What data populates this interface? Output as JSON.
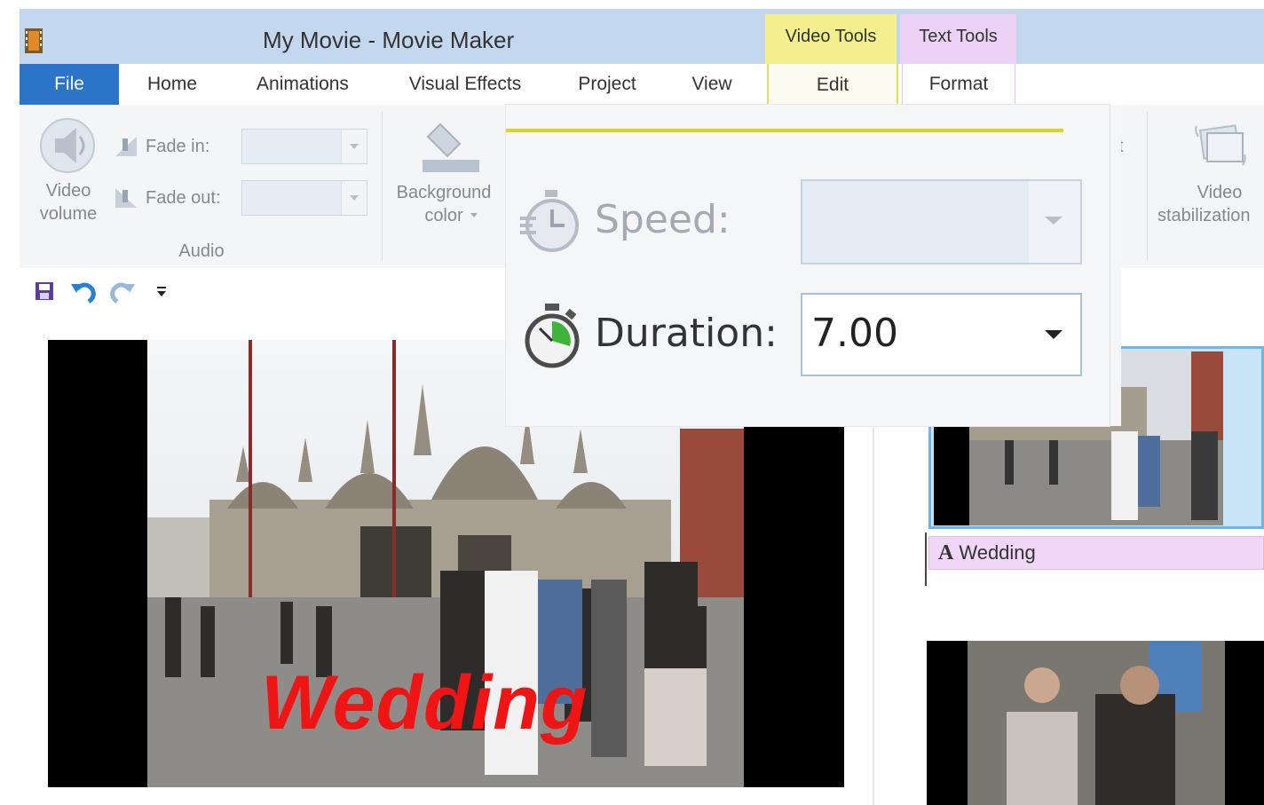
{
  "window": {
    "title": "My Movie - Movie Maker"
  },
  "context_tabs": {
    "video_tools": "Video Tools",
    "text_tools": "Text Tools"
  },
  "tabs": [
    "File",
    "Home",
    "Animations",
    "Visual Effects",
    "Project",
    "View",
    "Edit",
    "Format"
  ],
  "ribbon": {
    "video_volume": [
      "Video",
      "volume"
    ],
    "fade_in": "Fade in:",
    "fade_out": "Fade out:",
    "audio_group": "Audio",
    "background_color": [
      "Background",
      "color"
    ],
    "video_stabilization": [
      "Video",
      "stabilization"
    ],
    "partial_char": "t"
  },
  "popup": {
    "speed_label": "Speed:",
    "duration_label": "Duration:",
    "duration_value": "7.00"
  },
  "preview": {
    "caption": "Wedding"
  },
  "storyboard": {
    "clip1_caption": "Wedding",
    "caption_icon": "A"
  },
  "colors": {
    "file_tab": "#2b74c7",
    "video_tools": "#f2ef8c",
    "text_tools": "#ecd2f5",
    "caption_red": "#f01515"
  }
}
